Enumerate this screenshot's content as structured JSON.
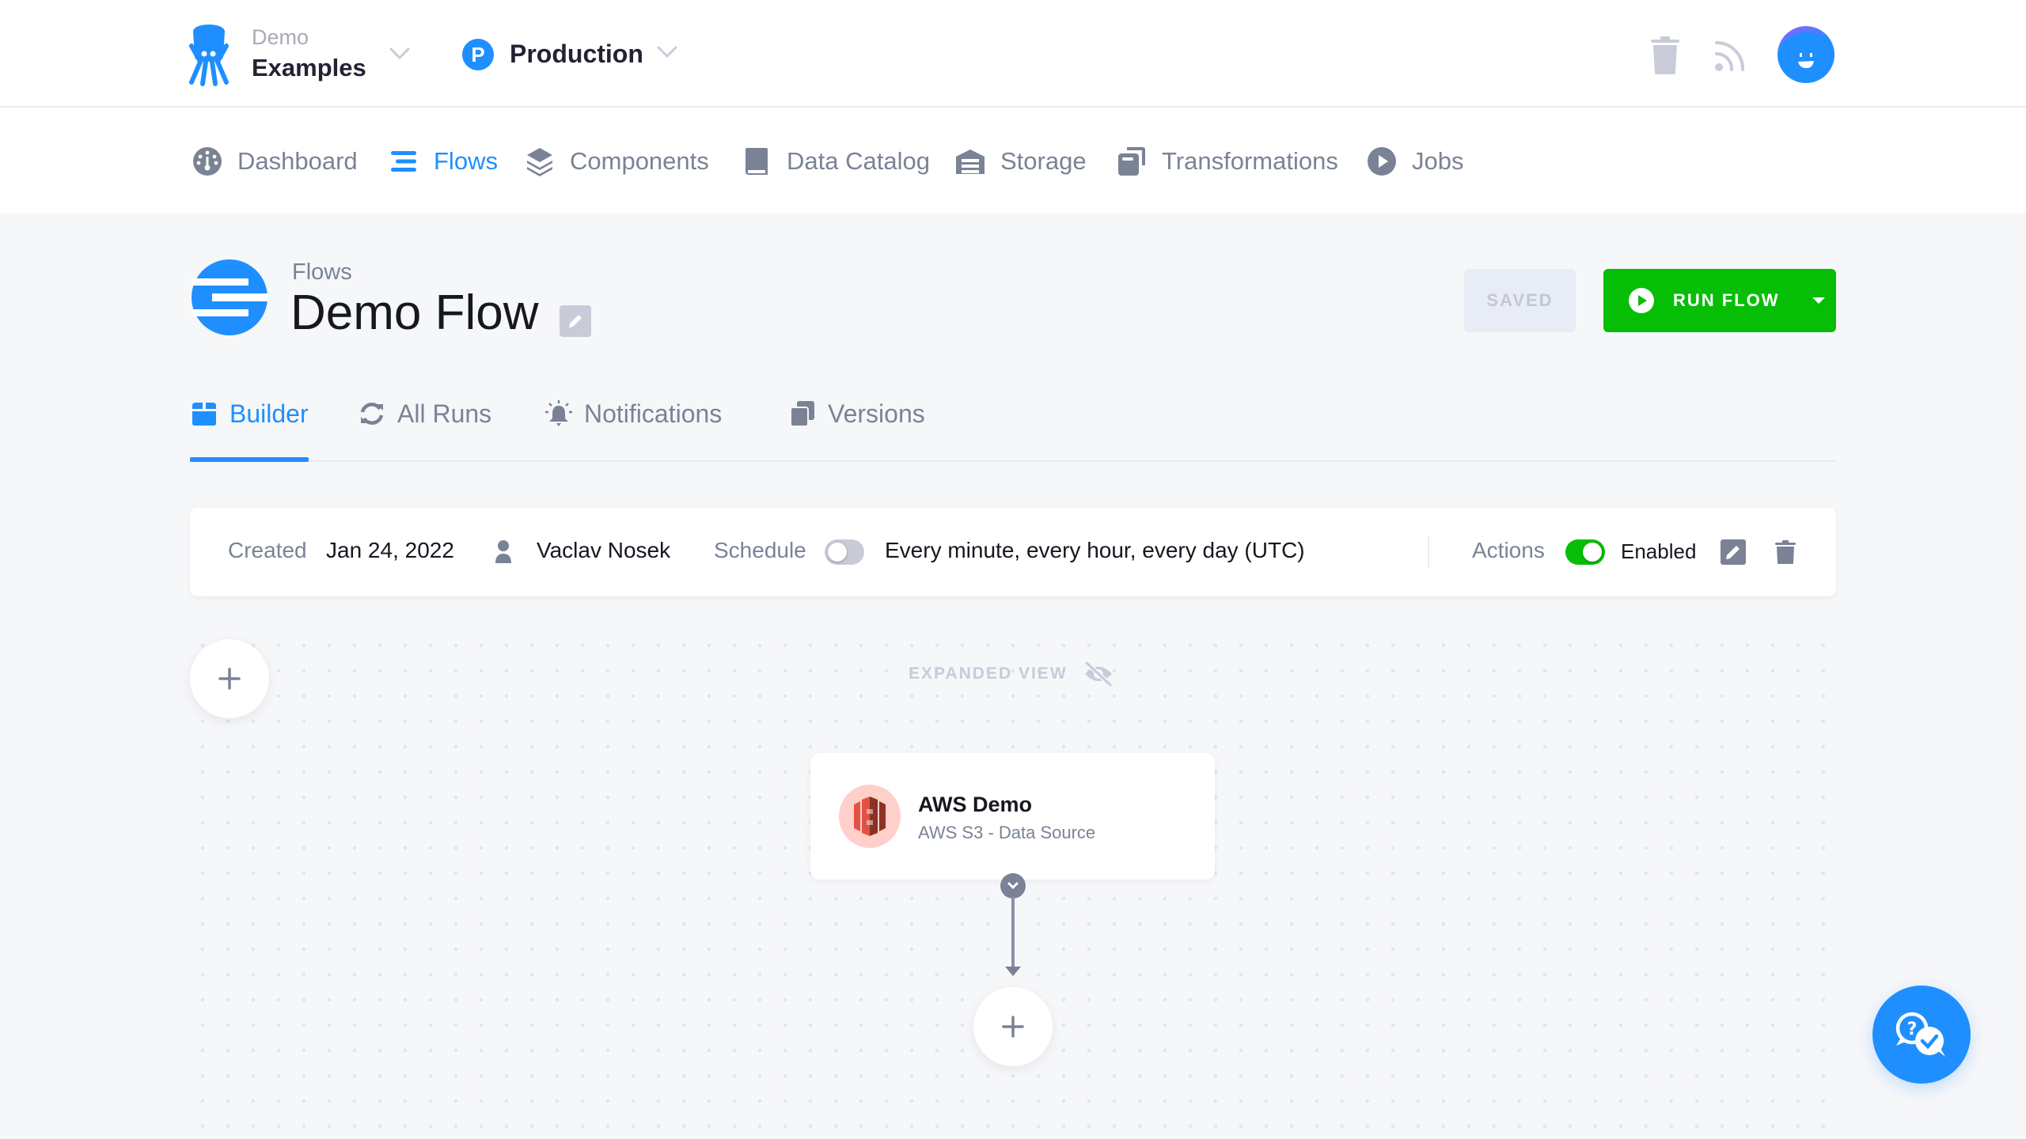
{
  "header": {
    "project_label": "Demo",
    "project_name": "Examples",
    "environment_badge": "P",
    "environment_name": "Production",
    "icons": [
      "trash-icon",
      "rss-icon",
      "user-avatar"
    ]
  },
  "nav": {
    "items": [
      {
        "label": "Dashboard",
        "icon": "dashboard-gauge-icon",
        "active": false
      },
      {
        "label": "Flows",
        "icon": "flows-bars-icon",
        "active": true
      },
      {
        "label": "Components",
        "icon": "layers-icon",
        "active": false
      },
      {
        "label": "Data Catalog",
        "icon": "book-icon",
        "active": false
      },
      {
        "label": "Storage",
        "icon": "warehouse-icon",
        "active": false
      },
      {
        "label": "Transformations",
        "icon": "transformations-icon",
        "active": false
      },
      {
        "label": "Jobs",
        "icon": "play-circle-icon",
        "active": false
      }
    ]
  },
  "page": {
    "breadcrumb": "Flows",
    "title": "Demo Flow",
    "saved_label": "SAVED",
    "run_label": "RUN FLOW"
  },
  "tabs": [
    {
      "label": "Builder",
      "icon": "builder-icon",
      "active": true
    },
    {
      "label": "All Runs",
      "icon": "refresh-icon",
      "active": false
    },
    {
      "label": "Notifications",
      "icon": "bell-icon",
      "active": false
    },
    {
      "label": "Versions",
      "icon": "versions-icon",
      "active": false
    }
  ],
  "info": {
    "created_label": "Created",
    "created_value": "Jan 24, 2022",
    "author": "Vaclav Nosek",
    "schedule_label": "Schedule",
    "schedule_enabled": false,
    "schedule_value": "Every minute, every hour, every day (UTC)",
    "actions_label": "Actions",
    "actions_enabled": true,
    "enabled_label": "Enabled"
  },
  "canvas": {
    "expanded_view_label": "EXPANDED VIEW",
    "nodes": [
      {
        "title": "AWS Demo",
        "subtitle": "AWS S3 - Data Source",
        "icon": "aws-s3-icon"
      }
    ]
  },
  "colors": {
    "accent": "#1f8fff",
    "success": "#07be07",
    "muted_text": "#7a8395",
    "page_bg": "#f6f7f9"
  }
}
